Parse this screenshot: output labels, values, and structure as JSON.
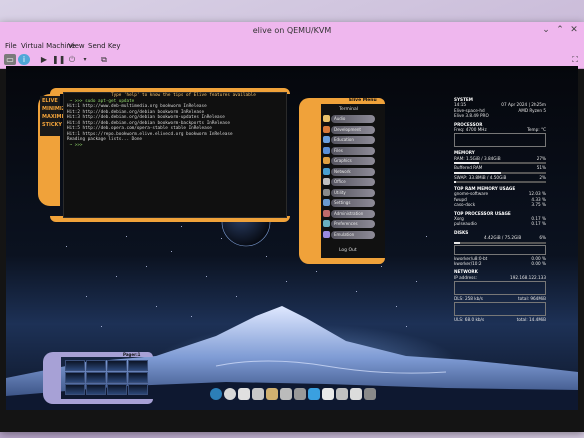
{
  "window": {
    "title": "elive on QEMU/KVM",
    "menu": [
      "File",
      "Virtual Machine",
      "View",
      "Send Key"
    ],
    "controls": {
      "close": "✕",
      "minimize": "⌄",
      "maximize": "⌃"
    }
  },
  "toolbar": {
    "icons": [
      "display-icon",
      "info-icon",
      "play-icon",
      "pause-icon",
      "power-icon",
      "dropdown-icon",
      "snapshot-icon",
      "fullscreen-icon"
    ]
  },
  "lcars": {
    "labels": [
      "ELIVE",
      "MINIMIZE",
      "MAXIMIZE",
      "STICKY"
    ]
  },
  "terminal": {
    "lines": [
      "                 Type 'help' to know the tips of Elive features available",
      " ~ >>> sudo apt-get update",
      "Hit:1 http://www.deb-multimedia.org bookworm InRelease",
      "Hit:2 http://deb.debian.org/debian bookworm InRelease",
      "Hit:3 http://deb.debian.org/debian bookworm-updates InRelease",
      "Hit:4 http://deb.debian.org/debian bookworm-backports InRelease",
      "Hit:5 http://deb.opera.com/opera-stable stable InRelease",
      "Hit:1 https://repo.bookworm.elive.elivecd.org bookworm InRelease",
      "Reading package lists... Done",
      " ~ >>> "
    ]
  },
  "elive_menu": {
    "title": "Elive Menu",
    "header": "Terminal",
    "items": [
      "Audio",
      "Development",
      "Education",
      "Files",
      "Graphics",
      "Network",
      "Office",
      "Utility",
      "Settings",
      "Administration",
      "Preferences",
      "Emulation"
    ],
    "footer": "Log Out"
  },
  "conky": {
    "system_title": "SYSTEM",
    "time": "14:15",
    "date": "07 Apr 2024 | 2h25m",
    "host": "Elive-space-hd",
    "cpu": "AMD Ryzen 5",
    "kernel": "Elive 3.8.49 PRO",
    "proc_title": "PROCESSOR",
    "freq": "Freq: 4700 MHz",
    "temp": "Temp: °C",
    "mem_title": "MEMORY",
    "ram": "RAM: 1.5GiB / 3.84GiB",
    "ram_pct": "27%",
    "ram_frac": 0.27,
    "buffered": "Buffered RAM",
    "buffered_pct": "51%",
    "buffered_frac": 0.51,
    "swap": "SWAP: 33.8MiB / 4.50GiB",
    "swap_pct": "2%",
    "swap_frac": 0.02,
    "top_ram_title": "TOP RAM MEMORY USAGE",
    "top_ram": [
      [
        "gnome-software",
        "12.03 %"
      ],
      [
        "fwupd",
        "4.33 %"
      ],
      [
        "caso-dock",
        "3.75 %"
      ]
    ],
    "top_cpu_title": "TOP PROCESSOR USAGE",
    "top_cpu": [
      [
        "Xorg",
        "0.17 %"
      ],
      [
        "pulseaudio",
        "0.17 %"
      ]
    ],
    "disks_title": "DISKS",
    "disk": "4.42GiB / 75.2GiB",
    "disk_pct": "6%",
    "disk_frac": 0.06,
    "kworkers": [
      [
        "kworker/u8:0-bt",
        "0.00 %"
      ],
      [
        "kworker/10:2",
        "0.00 %"
      ]
    ],
    "net_title": "NETWORK",
    "ip_label": "IP address:",
    "ip": "192.168.122.133",
    "down": "DLS: 258 kb/s",
    "down_total": "total: 964MiB",
    "up": "ULS: 68.0 kb/s",
    "up_total": "total: 14.4MiB"
  },
  "pager": {
    "title": "Pager:1"
  },
  "dock": {
    "icons": [
      "elive-icon",
      "disc-icon",
      "home-icon",
      "mail-icon",
      "folder-icon",
      "speaker-icon",
      "trash-icon",
      "wifi-icon",
      "battery-icon",
      "calendar-icon",
      "clock-icon",
      "bin-icon"
    ]
  }
}
